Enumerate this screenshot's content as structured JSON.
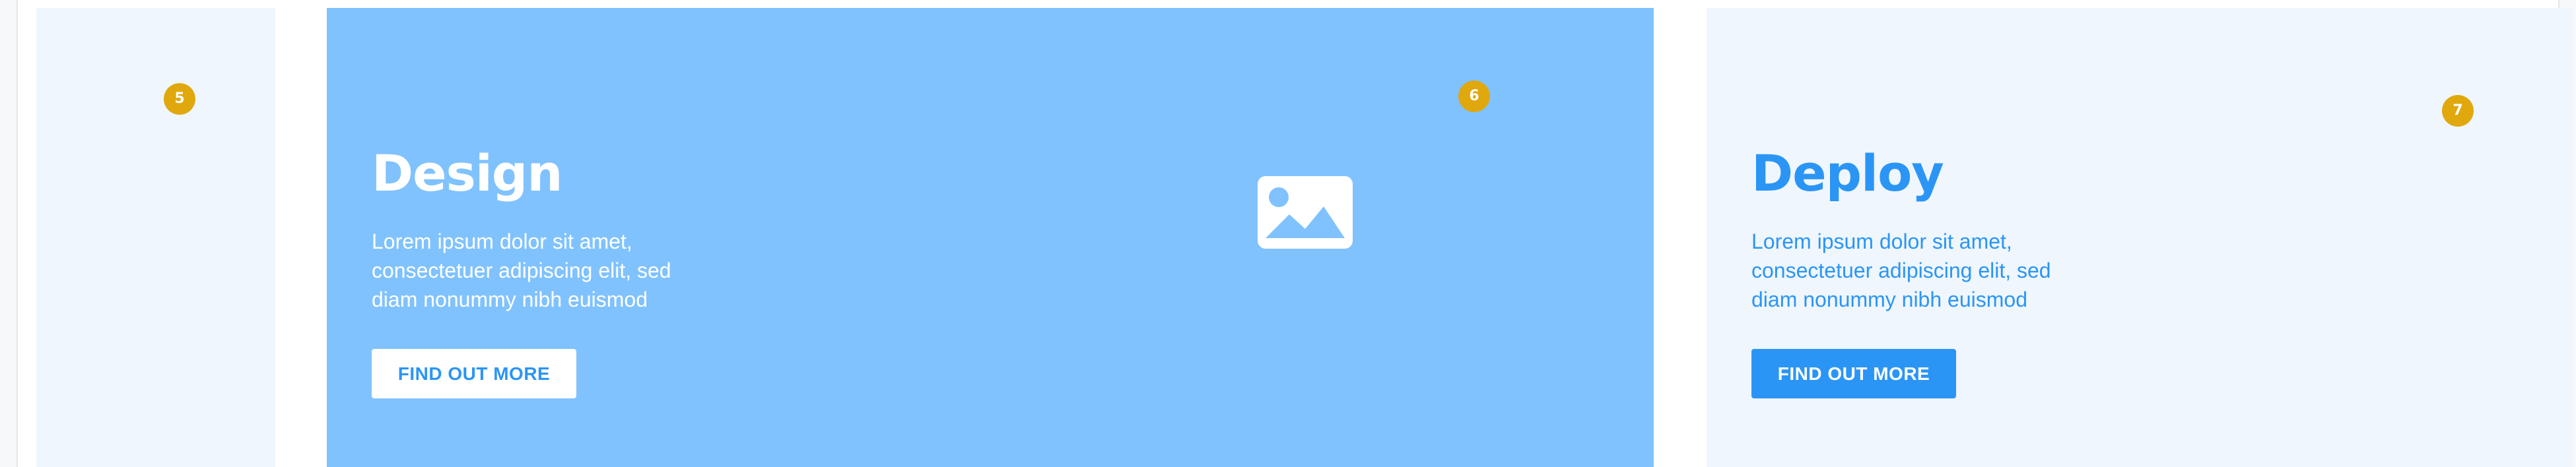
{
  "colors": {
    "accent": "#2b95f5",
    "card_light": "#eff6fd",
    "card_highlight": "#80c2fe",
    "badge": "#e0a80d"
  },
  "slides": [
    {
      "badge": "5"
    },
    {
      "title": "Design",
      "description": "Lorem ipsum dolor sit amet, consectetuer adipiscing elit, sed diam nonummy nibh euismod",
      "button_label": "FIND OUT MORE",
      "badge": "6",
      "icon": "image-icon"
    },
    {
      "title": "Deploy",
      "description": "Lorem ipsum dolor sit amet, consectetuer adipiscing elit, sed diam nonummy nibh euismod",
      "button_label": "FIND OUT MORE",
      "badge": "7"
    }
  ]
}
